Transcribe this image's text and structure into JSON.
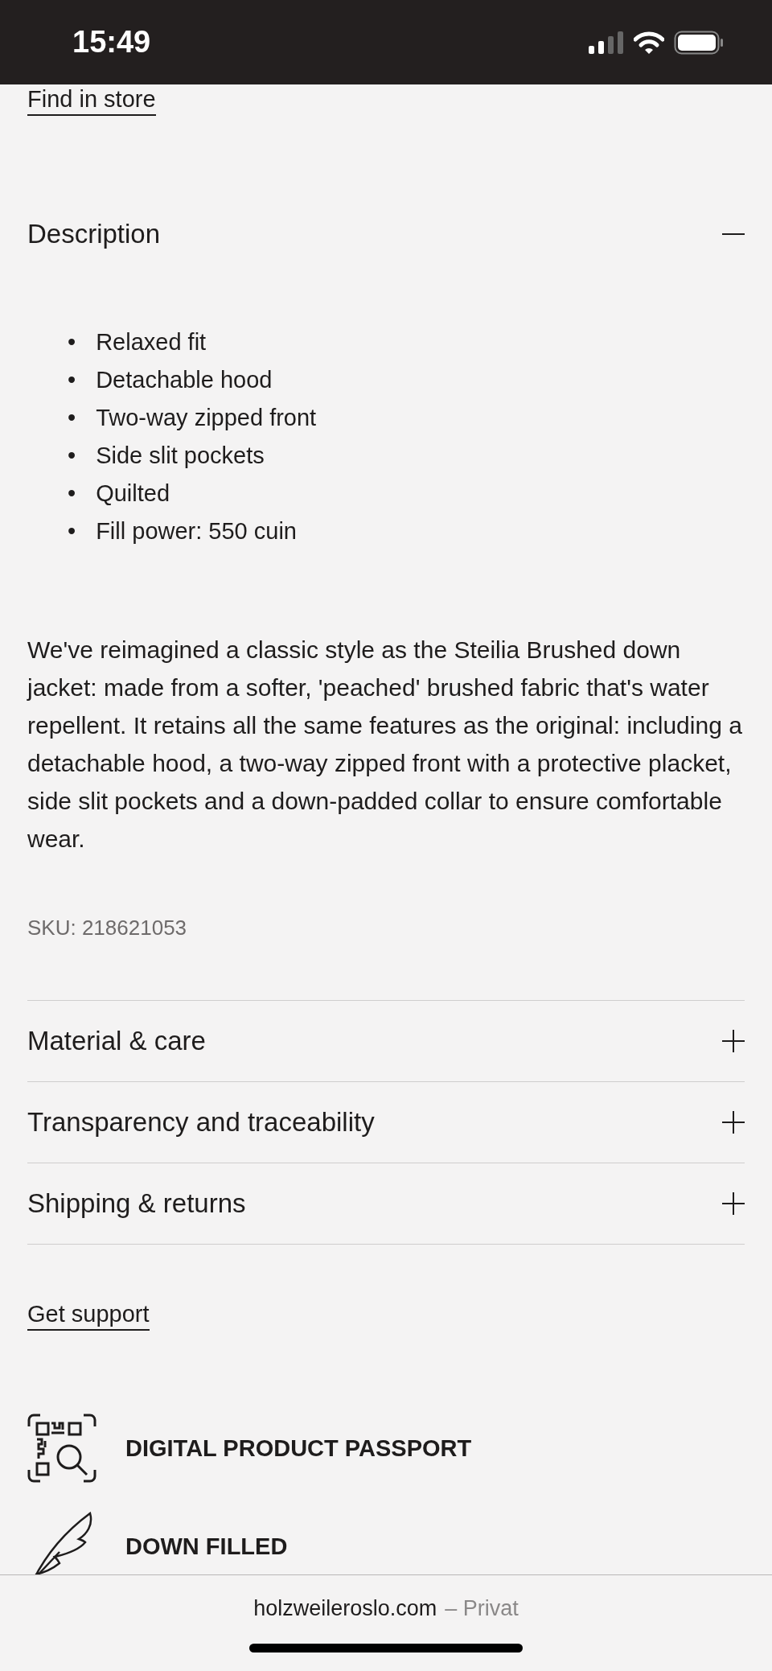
{
  "status_bar": {
    "time": "15:49"
  },
  "find_in_store": "Find in store",
  "sections": [
    {
      "title": "Description",
      "expanded": true,
      "bullets": [
        {
          "marker": "•",
          "text": "Relaxed fit"
        },
        {
          "marker": "•",
          "text": "Detachable hood"
        },
        {
          "marker": "•",
          "text": "Two-way zipped front"
        },
        {
          "marker": "•",
          "text": "Side slit pockets"
        },
        {
          "marker": "•",
          "text": "Quilted"
        },
        {
          "marker": "•",
          "text": "Fill power: 550 cuin"
        }
      ],
      "paragraph": "We've reimagined a classic style as the Steilia Brushed down jacket: made from a softer, 'peached' brushed fabric that's water repellent. It retains all the same features as the original: including a detachable hood, a two-way zipped front with a protective placket, side slit pockets and a down-padded collar to ensure comfortable wear.",
      "sku": "SKU: 218621053"
    },
    {
      "title": "Material & care",
      "expanded": false
    },
    {
      "title": "Transparency and traceability",
      "expanded": false
    },
    {
      "title": "Shipping & returns",
      "expanded": false
    }
  ],
  "get_support": "Get support",
  "features": [
    {
      "kind": "passport",
      "label": "DIGITAL PRODUCT PASSPORT"
    },
    {
      "kind": "feather",
      "label": "DOWN FILLED"
    }
  ],
  "browser_bar": {
    "domain": "holzweileroslo.com",
    "mode": "– Privat"
  }
}
